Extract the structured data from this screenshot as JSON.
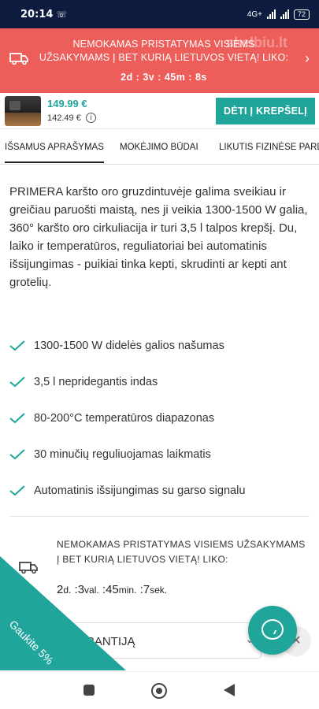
{
  "status_bar": {
    "time": "20:14",
    "network": "4G+",
    "battery": "72"
  },
  "promo_banner": {
    "text": "NEMOKAMAS PRISTATYMAS VISIEMS UŽSAKYMAMS Į BET KURIĄ LIETUVOS VIETĄ! LIKO:",
    "timer": "2d : 3v : 45m : 8s",
    "watermark": "skelbiu.lt"
  },
  "product_bar": {
    "price": "149.99 €",
    "alt_price": "142.49 €",
    "cart_button": "DĖTI Į KREPŠELĮ"
  },
  "tabs": [
    {
      "label": "IŠSAMUS APRAŠYMAS",
      "active": true
    },
    {
      "label": "MOKĖJIMO BŪDAI",
      "active": false
    },
    {
      "label": "LIKUTIS FIZINĖSE PARD",
      "active": false
    }
  ],
  "description": "PRIMERA karšto oro gruzdintuvėje galima sveikiau ir greičiau paruošti maistą, nes ji veikia 1300-1500 W galia, 360° karšto oro cirkuliacija ir turi 3,5 l talpos krepšį. Du, laiko ir temperatūros, reguliatoriai bei automatinis išsijungimas - puikiai tinka kepti, skrudinti ar kepti ant grotelių.",
  "features": [
    "1300-1500 W didelės galios našumas",
    "3,5 l nepridegantis indas",
    "80-200°C temperatūros diapazonas",
    "30 minučių reguliuojamas laikmatis",
    "Automatinis išsijungimas su garso signalu"
  ],
  "shipping": {
    "text": "NEMOKAMAS PRISTATYMAS VISIEMS UŽSAKYMAMS Į BET KURIĄ LIETUVOS VIETĄ! LIKO:",
    "days": "2",
    "days_unit": "d.",
    "hours": "3",
    "hours_unit": "val.",
    "minutes": "45",
    "minutes_unit": "min.",
    "seconds": "7",
    "seconds_unit": "sek."
  },
  "warranty": {
    "label": "ARANTIJĄ"
  },
  "discount_badge": "Gaukite 5%",
  "colors": {
    "accent": "#1fa59a",
    "promo": "#ed5e5a",
    "status_bar": "#0d1b3e"
  },
  "icons": [
    "truck-icon",
    "chevron-right-icon",
    "info-icon",
    "check-icon",
    "chevron-down-icon",
    "chat-icon",
    "close-icon"
  ]
}
